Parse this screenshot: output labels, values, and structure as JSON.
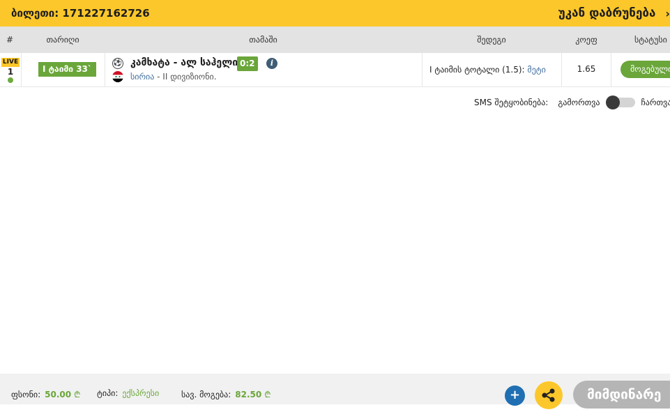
{
  "header": {
    "ticket_label": "ბილეთი: 171227162726",
    "back_label": "უკან დაბრუნება"
  },
  "table": {
    "columns": [
      "#",
      "თარიღი",
      "თამაში",
      "შედეგი",
      "კოეფ",
      "სტატუსი"
    ],
    "row": {
      "live_badge": "LIVE",
      "number": "1",
      "period": "I ტაიმი 33`",
      "match": "კამხატა - ალ საჰელი",
      "score": "0:2",
      "country": "სირია",
      "league": " - II დივიზიონი.",
      "result_text": "I ტაიმის ტოტალი (1.5): ",
      "result_pick": "მეტი",
      "odd": "1.65",
      "status": "მოგებული"
    }
  },
  "sms": {
    "label": "SMS შეტყობინება:",
    "off_label": "გამორთვა",
    "on_label": "ჩართვა",
    "enabled": false
  },
  "footer": {
    "stake_label": "ფსონი:",
    "stake_value": "50.00",
    "type_label": "ტიპი:",
    "type_value": "ექსპრესი",
    "payout_label": "სავ. მოგება:",
    "payout_value": "82.50",
    "currency": "₾",
    "plus_label": "+",
    "current_label": "მიმდინარე"
  },
  "colors": {
    "accent_yellow": "#fcc72a",
    "win_green": "#6aa63a",
    "link_blue": "#3f6e9e",
    "plus_blue": "#1f6fb2"
  }
}
